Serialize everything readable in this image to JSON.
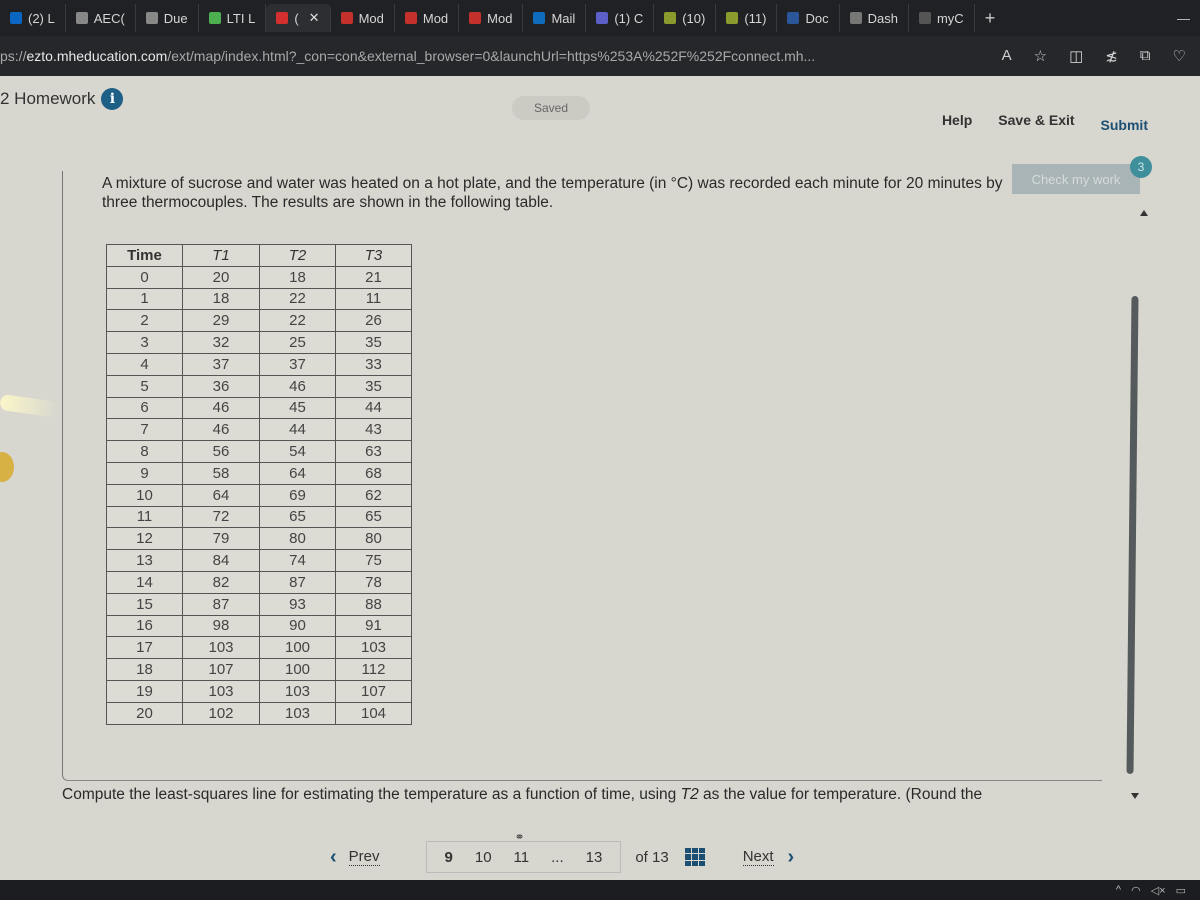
{
  "browser": {
    "tabs": [
      {
        "label": "(2) L",
        "icon": "linkedin-icon",
        "color": "#0a66c2"
      },
      {
        "label": "AEC(",
        "icon": "a-icon",
        "color": "#888888"
      },
      {
        "label": "Due",
        "icon": "s-icon",
        "color": "#888888"
      },
      {
        "label": "LTI L",
        "icon": "bar-chart-icon",
        "color": "#4caf50"
      },
      {
        "label": "(",
        "icon": "m-icon",
        "color": "#d32f2f",
        "active": true
      },
      {
        "label": "Mod",
        "icon": "youtube-icon",
        "color": "#c4302b"
      },
      {
        "label": "Mod",
        "icon": "youtube-icon",
        "color": "#c4302b"
      },
      {
        "label": "Mod",
        "icon": "youtube-icon",
        "color": "#c4302b"
      },
      {
        "label": "Mail",
        "icon": "outlook-icon",
        "color": "#0f6cbd"
      },
      {
        "label": "(1) C",
        "icon": "teams-icon",
        "color": "#5b5fc7"
      },
      {
        "label": "(10)",
        "icon": "h-icon",
        "color": "#8a9a2c"
      },
      {
        "label": "(11)",
        "icon": "h-icon",
        "color": "#8a9a2c"
      },
      {
        "label": "Doc",
        "icon": "word-icon",
        "color": "#2b579a"
      },
      {
        "label": "Dash",
        "icon": "dash-icon",
        "color": "#777777"
      },
      {
        "label": "myC",
        "icon": "myc-icon",
        "color": "#555555"
      }
    ],
    "new_tab": "+",
    "minimize": "—",
    "url_prefix": "ps://",
    "url_host": "ezto.mheducation.com",
    "url_rest": "/ext/map/index.html?_con=con&external_browser=0&launchUrl=https%253A%252F%252Fconnect.mh...",
    "address_icons": [
      "read-aloud-icon",
      "favorite-star-icon",
      "split-screen-icon",
      "favorites-list-icon",
      "collections-icon",
      "browser-essentials-icon"
    ]
  },
  "header": {
    "title": "2 Homework",
    "info": "i",
    "saved": "Saved",
    "help": "Help",
    "save_exit": "Save & Exit",
    "submit": "Submit",
    "check_my_work": "Check my work",
    "check_badge": "3"
  },
  "question": {
    "text": "A mixture of sucrose and water was heated on a hot plate, and the temperature (in °C) was recorded each minute for 20 minutes by three thermocouples. The results are shown in the following table.",
    "table": {
      "headers": [
        "Time",
        "T1",
        "T2",
        "T3"
      ],
      "rows": [
        [
          "0",
          "20",
          "18",
          "21"
        ],
        [
          "1",
          "18",
          "22",
          "11"
        ],
        [
          "2",
          "29",
          "22",
          "26"
        ],
        [
          "3",
          "32",
          "25",
          "35"
        ],
        [
          "4",
          "37",
          "37",
          "33"
        ],
        [
          "5",
          "36",
          "46",
          "35"
        ],
        [
          "6",
          "46",
          "45",
          "44"
        ],
        [
          "7",
          "46",
          "44",
          "43"
        ],
        [
          "8",
          "56",
          "54",
          "63"
        ],
        [
          "9",
          "58",
          "64",
          "68"
        ],
        [
          "10",
          "64",
          "69",
          "62"
        ],
        [
          "11",
          "72",
          "65",
          "65"
        ],
        [
          "12",
          "79",
          "80",
          "80"
        ],
        [
          "13",
          "84",
          "74",
          "75"
        ],
        [
          "14",
          "82",
          "87",
          "78"
        ],
        [
          "15",
          "87",
          "93",
          "88"
        ],
        [
          "16",
          "98",
          "90",
          "91"
        ],
        [
          "17",
          "103",
          "100",
          "103"
        ],
        [
          "18",
          "107",
          "100",
          "112"
        ],
        [
          "19",
          "103",
          "103",
          "107"
        ],
        [
          "20",
          "102",
          "103",
          "104"
        ]
      ]
    },
    "prompt_before": "Compute the least-squares line for estimating the temperature as a function of time, using ",
    "prompt_var": "T2",
    "prompt_after": " as the value for temperature. (Round the"
  },
  "pager": {
    "prev": "Prev",
    "pages": [
      "9",
      "10",
      "11",
      "...",
      "13"
    ],
    "current": "9",
    "of_label": "of 13",
    "next": "Next"
  },
  "colors": {
    "accent": "#1d4f73",
    "info_icon": "#1d5f85",
    "badge": "#3f8f9c"
  }
}
